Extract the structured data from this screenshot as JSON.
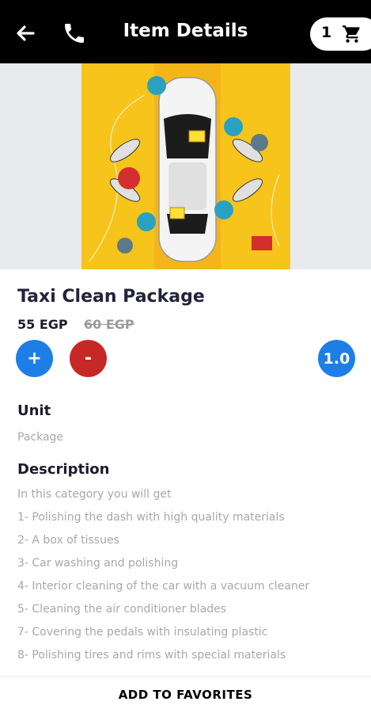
{
  "header": {
    "title": "Item Details",
    "cart_count": "1"
  },
  "icons": {
    "back": "back-arrow-icon",
    "call": "phone-icon",
    "cart": "cart-icon"
  },
  "item": {
    "name": "Taxi Clean Package",
    "price": "55 EGP",
    "old_price": "60 EGP",
    "plus_label": "+",
    "minus_label": "-",
    "quantity": "1.0"
  },
  "unit": {
    "heading": "Unit",
    "value": "Package"
  },
  "description": {
    "heading": "Description",
    "lines": [
      "In this category you will get",
      "1- Polishing the dash with high quality materials",
      "2- A box of tissues",
      "3- Car washing and polishing",
      "4- Interior cleaning of the car with a vacuum cleaner",
      "5- Cleaning the air conditioner blades",
      "7- Covering the pedals with insulating plastic",
      "8- Polishing tires and rims with special materials"
    ]
  },
  "footer": {
    "favorites_label": "ADD TO FAVORITES"
  },
  "colors": {
    "header_bg": "#000000",
    "accent_blue": "#1d7fe6",
    "accent_red": "#c62828",
    "hero_yellow": "#f6c41b"
  }
}
